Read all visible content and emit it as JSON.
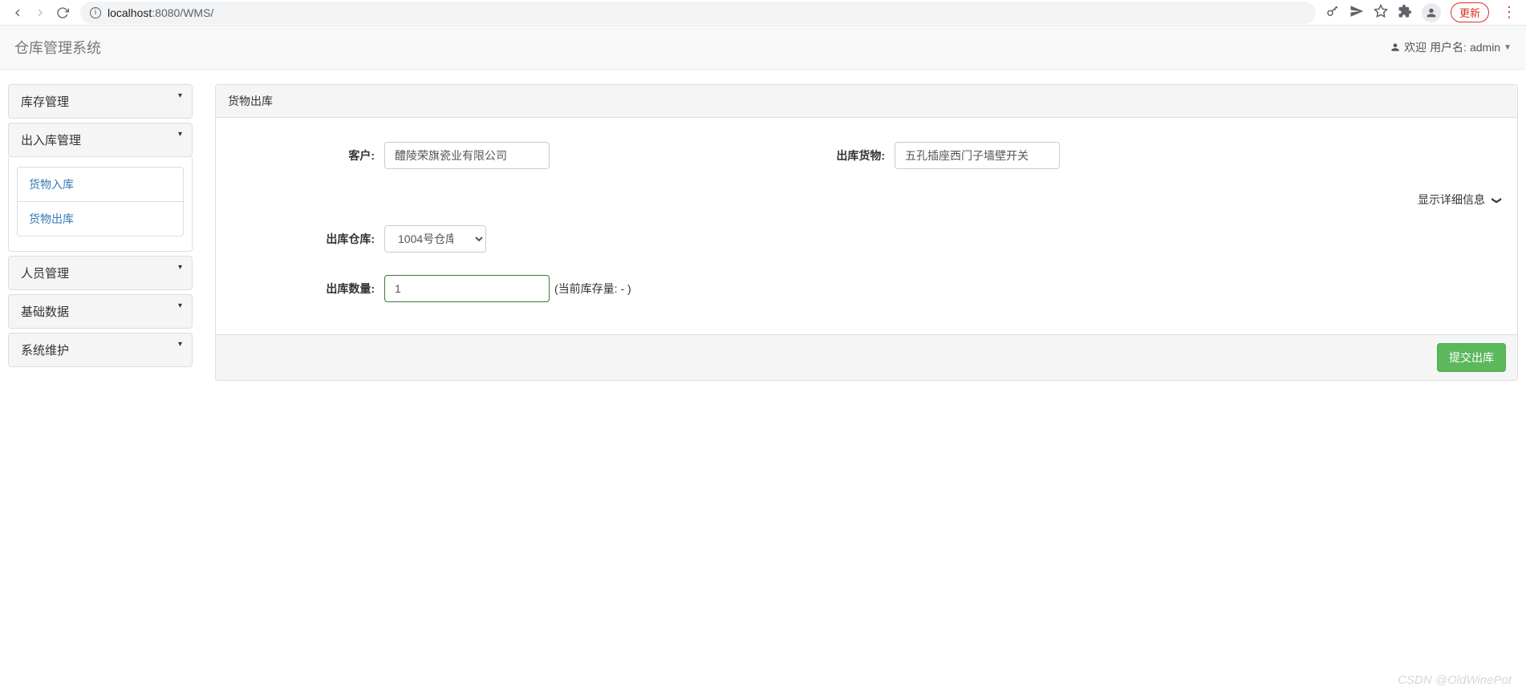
{
  "browser": {
    "url_host": "localhost",
    "url_port_path": ":8080/WMS/",
    "update_label": "更新"
  },
  "header": {
    "title": "仓库管理系统",
    "welcome": "欢迎",
    "username_label": "用户名:",
    "username": "admin"
  },
  "sidebar": {
    "items": [
      {
        "label": "库存管理",
        "expanded": false
      },
      {
        "label": "出入库管理",
        "expanded": true,
        "children": [
          {
            "label": "货物入库"
          },
          {
            "label": "货物出库"
          }
        ]
      },
      {
        "label": "人员管理",
        "expanded": false
      },
      {
        "label": "基础数据",
        "expanded": false
      },
      {
        "label": "系统维护",
        "expanded": false
      }
    ]
  },
  "main": {
    "title": "货物出库",
    "form": {
      "customer_label": "客户:",
      "customer_value": "醴陵荣旗瓷业有限公司",
      "goods_label": "出库货物:",
      "goods_value": "五孔插座西门子墙壁开关",
      "details_toggle": "显示详细信息",
      "warehouse_label": "出库仓库:",
      "warehouse_value": "1004号仓库",
      "qty_label": "出库数量:",
      "qty_value": "1",
      "stock_hint": "(当前库存量:    - )"
    },
    "submit_label": "提交出库"
  },
  "watermark": "CSDN @OldWinePot"
}
